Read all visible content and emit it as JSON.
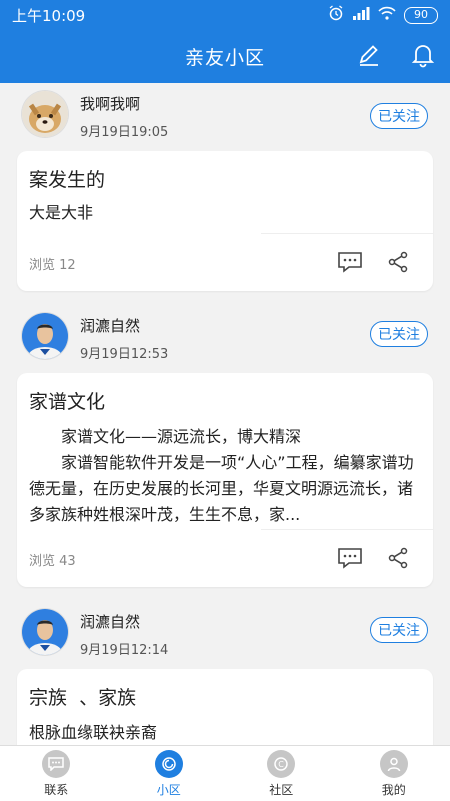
{
  "status_bar": {
    "time": "上午10:09",
    "battery": "90",
    "icons": [
      "alarm-icon",
      "signal-icon",
      "wifi-icon",
      "battery-icon"
    ]
  },
  "app_bar": {
    "title": "亲友小区",
    "icons": [
      "edit-icon",
      "bell-icon"
    ]
  },
  "posts": [
    {
      "author": "我啊我啊",
      "time": "9月19日19:05",
      "follow_label": "已关注",
      "title": "案发生的",
      "body": [
        "大是大非"
      ],
      "views": "浏览 12"
    },
    {
      "author": "润瀌自然",
      "time": "9月19日12:53",
      "follow_label": "已关注",
      "title": "家谱文化",
      "body": [
        "家谱文化——源远流长，博大精深",
        "家谱智能软件开发是一项“人心”工程，编纂家谱功德无量，在历史发展的长河里，华夏文明源远流长，诸多家族种姓根深叶茂，生生不息，家..."
      ],
      "views": "浏览 43"
    },
    {
      "author": "润瀌自然",
      "time": "9月19日12:14",
      "follow_label": "已关注",
      "title": "宗族  、家族",
      "body": [
        "根脉血缘联袂亲裔"
      ],
      "views": ""
    }
  ],
  "tab_bar": {
    "tabs": [
      {
        "label": "联系",
        "icon": "chat-icon",
        "active": false
      },
      {
        "label": "小区",
        "icon": "community-icon",
        "active": true
      },
      {
        "label": "社区",
        "icon": "society-icon",
        "active": false
      },
      {
        "label": "我的",
        "icon": "profile-icon",
        "active": false
      }
    ]
  },
  "colors": {
    "primary": "#1f7fe0",
    "background": "#f2f2f2",
    "inactive_tab": "#c6c6c6"
  }
}
